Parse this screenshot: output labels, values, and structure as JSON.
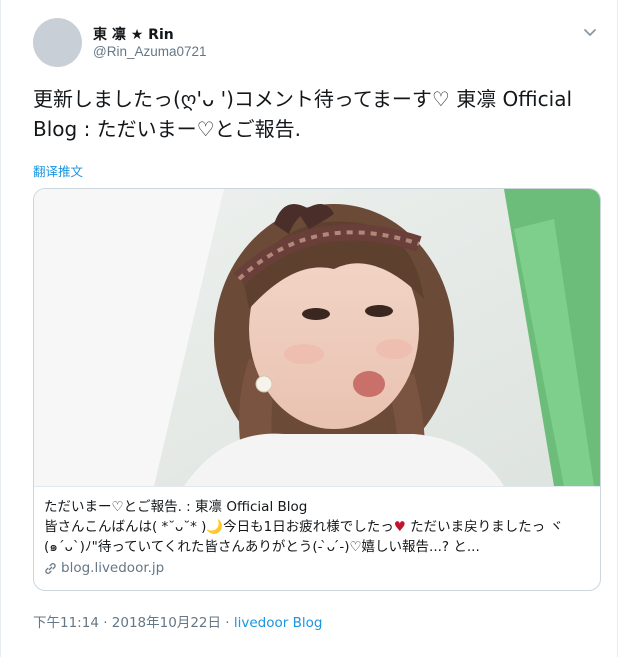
{
  "user": {
    "display_name": "東 凛 ★ Rin",
    "handle": "@Rin_Azuma0721"
  },
  "tweet": {
    "text": "更新しましたっ(ღ'ᴗ  ')コメント待ってまーす♡ 東凛 Official Blog : ただいまー♡とご報告.",
    "translate_label": "翻译推文"
  },
  "card": {
    "title": "ただいまー♡とご報告. : 東凛 Official Blog",
    "desc_part1": "皆さんこんばんは( *˘ᴗ˘* )🌙今日も1日お疲れ様でしたっ",
    "desc_heart": "♥",
    "desc_part2": " ただいま戻りましたっ ヾ(๑ˊᴗˋ)ﾉ\"待っていてくれた皆さんありがとう(- ̀ᴗ ́-)♡嬉しい報告...? と...",
    "url": "blog.livedoor.jp"
  },
  "meta": {
    "timestamp": "下午11:14 · 2018年10月22日 · ",
    "source": "livedoor Blog"
  },
  "colors": {
    "link": "#1b95e0",
    "secondary": "#657786",
    "border": "#ccd6dd"
  }
}
